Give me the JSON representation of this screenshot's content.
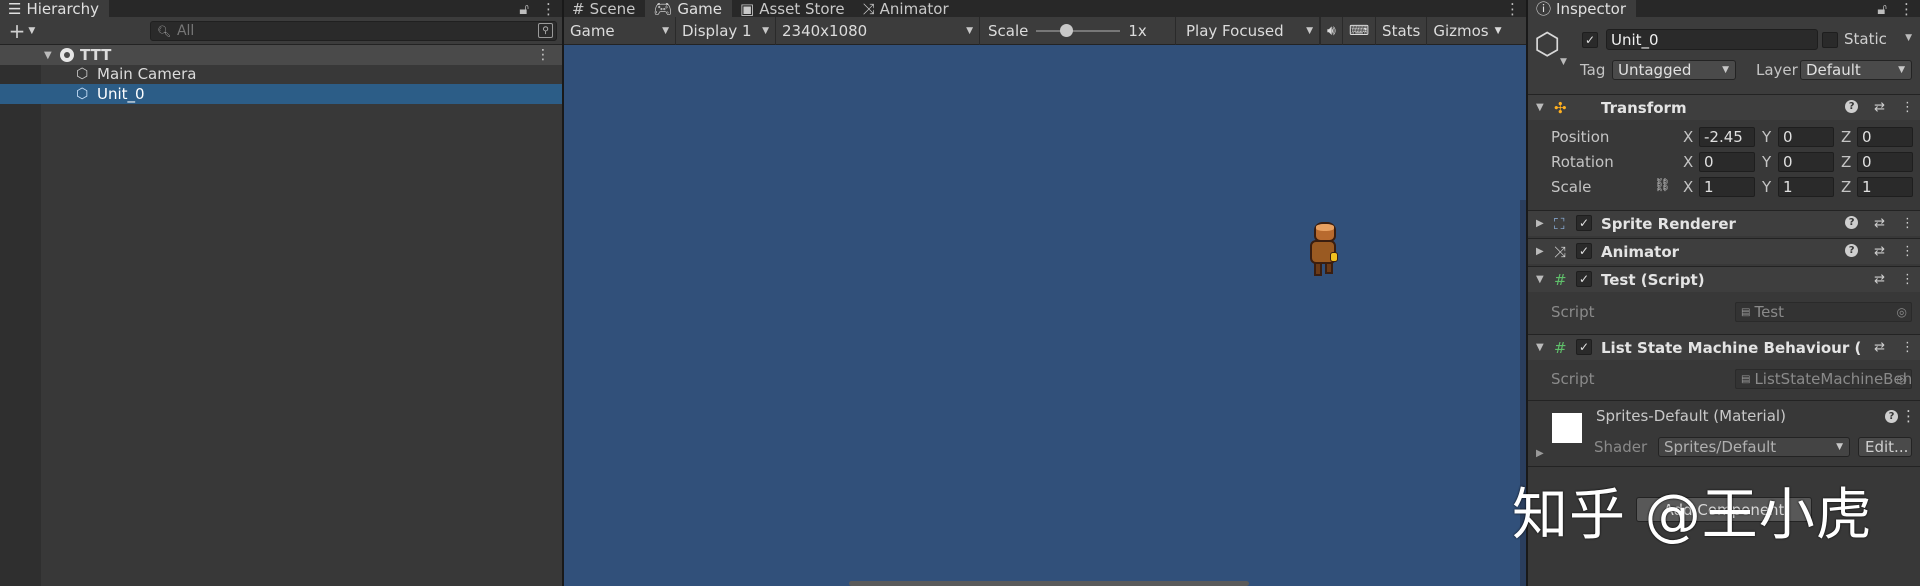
{
  "hierarchy": {
    "tab_label": "Hierarchy",
    "add_label": "+",
    "search_placeholder": "All",
    "scene_name": "TTT",
    "items": [
      {
        "label": "Main Camera"
      },
      {
        "label": "Unit_0"
      }
    ]
  },
  "game_view": {
    "tabs": [
      {
        "label": "Scene"
      },
      {
        "label": "Game"
      },
      {
        "label": "Asset Store"
      },
      {
        "label": "Animator"
      }
    ],
    "view_mode": "Game",
    "display": "Display 1",
    "resolution": "2340x1080",
    "scale_label": "Scale",
    "scale_value": "1x",
    "play_mode": "Play Focused",
    "stats_label": "Stats",
    "gizmos_label": "Gizmos",
    "background_color": "#31507a"
  },
  "inspector": {
    "tab_label": "Inspector",
    "object_name": "Unit_0",
    "static_label": "Static",
    "tag_label": "Tag",
    "tag_value": "Untagged",
    "layer_label": "Layer",
    "layer_value": "Default",
    "transform": {
      "title": "Transform",
      "position_label": "Position",
      "rotation_label": "Rotation",
      "scale_label": "Scale",
      "position": {
        "x": "-2.45",
        "y": "0",
        "z": "0"
      },
      "rotation": {
        "x": "0",
        "y": "0",
        "z": "0"
      },
      "scale": {
        "x": "1",
        "y": "1",
        "z": "1"
      }
    },
    "components": [
      {
        "title": "Sprite Renderer"
      },
      {
        "title": "Animator"
      },
      {
        "title": "Test (Script)",
        "script_label": "Script",
        "script_value": "Test"
      },
      {
        "title": "List State Machine Behaviour (Script)",
        "script_label": "Script",
        "script_value": "ListStateMachineBehaviour"
      }
    ],
    "material": {
      "title": "Sprites-Default (Material)",
      "shader_label": "Shader",
      "shader_value": "Sprites/Default",
      "edit_label": "Edit..."
    },
    "add_component_label": "Add Component"
  },
  "watermark": "知乎 @王小虎",
  "colors": {
    "selection": "#2c5d87",
    "panel": "#383838",
    "game_bg": "#31507a"
  }
}
